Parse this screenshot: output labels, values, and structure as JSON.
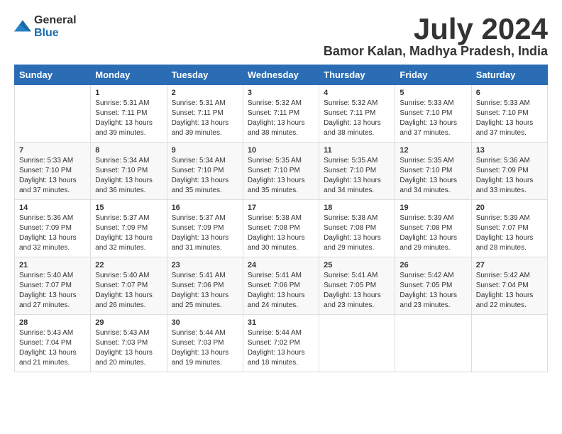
{
  "header": {
    "logo_general": "General",
    "logo_blue": "Blue",
    "month_year": "July 2024",
    "location": "Bamor Kalan, Madhya Pradesh, India"
  },
  "days_of_week": [
    "Sunday",
    "Monday",
    "Tuesday",
    "Wednesday",
    "Thursday",
    "Friday",
    "Saturday"
  ],
  "weeks": [
    [
      {
        "day": "",
        "info": ""
      },
      {
        "day": "1",
        "info": "Sunrise: 5:31 AM\nSunset: 7:11 PM\nDaylight: 13 hours\nand 39 minutes."
      },
      {
        "day": "2",
        "info": "Sunrise: 5:31 AM\nSunset: 7:11 PM\nDaylight: 13 hours\nand 39 minutes."
      },
      {
        "day": "3",
        "info": "Sunrise: 5:32 AM\nSunset: 7:11 PM\nDaylight: 13 hours\nand 38 minutes."
      },
      {
        "day": "4",
        "info": "Sunrise: 5:32 AM\nSunset: 7:11 PM\nDaylight: 13 hours\nand 38 minutes."
      },
      {
        "day": "5",
        "info": "Sunrise: 5:33 AM\nSunset: 7:10 PM\nDaylight: 13 hours\nand 37 minutes."
      },
      {
        "day": "6",
        "info": "Sunrise: 5:33 AM\nSunset: 7:10 PM\nDaylight: 13 hours\nand 37 minutes."
      }
    ],
    [
      {
        "day": "7",
        "info": "Sunrise: 5:33 AM\nSunset: 7:10 PM\nDaylight: 13 hours\nand 37 minutes."
      },
      {
        "day": "8",
        "info": "Sunrise: 5:34 AM\nSunset: 7:10 PM\nDaylight: 13 hours\nand 36 minutes."
      },
      {
        "day": "9",
        "info": "Sunrise: 5:34 AM\nSunset: 7:10 PM\nDaylight: 13 hours\nand 35 minutes."
      },
      {
        "day": "10",
        "info": "Sunrise: 5:35 AM\nSunset: 7:10 PM\nDaylight: 13 hours\nand 35 minutes."
      },
      {
        "day": "11",
        "info": "Sunrise: 5:35 AM\nSunset: 7:10 PM\nDaylight: 13 hours\nand 34 minutes."
      },
      {
        "day": "12",
        "info": "Sunrise: 5:35 AM\nSunset: 7:10 PM\nDaylight: 13 hours\nand 34 minutes."
      },
      {
        "day": "13",
        "info": "Sunrise: 5:36 AM\nSunset: 7:09 PM\nDaylight: 13 hours\nand 33 minutes."
      }
    ],
    [
      {
        "day": "14",
        "info": "Sunrise: 5:36 AM\nSunset: 7:09 PM\nDaylight: 13 hours\nand 32 minutes."
      },
      {
        "day": "15",
        "info": "Sunrise: 5:37 AM\nSunset: 7:09 PM\nDaylight: 13 hours\nand 32 minutes."
      },
      {
        "day": "16",
        "info": "Sunrise: 5:37 AM\nSunset: 7:09 PM\nDaylight: 13 hours\nand 31 minutes."
      },
      {
        "day": "17",
        "info": "Sunrise: 5:38 AM\nSunset: 7:08 PM\nDaylight: 13 hours\nand 30 minutes."
      },
      {
        "day": "18",
        "info": "Sunrise: 5:38 AM\nSunset: 7:08 PM\nDaylight: 13 hours\nand 29 minutes."
      },
      {
        "day": "19",
        "info": "Sunrise: 5:39 AM\nSunset: 7:08 PM\nDaylight: 13 hours\nand 29 minutes."
      },
      {
        "day": "20",
        "info": "Sunrise: 5:39 AM\nSunset: 7:07 PM\nDaylight: 13 hours\nand 28 minutes."
      }
    ],
    [
      {
        "day": "21",
        "info": "Sunrise: 5:40 AM\nSunset: 7:07 PM\nDaylight: 13 hours\nand 27 minutes."
      },
      {
        "day": "22",
        "info": "Sunrise: 5:40 AM\nSunset: 7:07 PM\nDaylight: 13 hours\nand 26 minutes."
      },
      {
        "day": "23",
        "info": "Sunrise: 5:41 AM\nSunset: 7:06 PM\nDaylight: 13 hours\nand 25 minutes."
      },
      {
        "day": "24",
        "info": "Sunrise: 5:41 AM\nSunset: 7:06 PM\nDaylight: 13 hours\nand 24 minutes."
      },
      {
        "day": "25",
        "info": "Sunrise: 5:41 AM\nSunset: 7:05 PM\nDaylight: 13 hours\nand 23 minutes."
      },
      {
        "day": "26",
        "info": "Sunrise: 5:42 AM\nSunset: 7:05 PM\nDaylight: 13 hours\nand 23 minutes."
      },
      {
        "day": "27",
        "info": "Sunrise: 5:42 AM\nSunset: 7:04 PM\nDaylight: 13 hours\nand 22 minutes."
      }
    ],
    [
      {
        "day": "28",
        "info": "Sunrise: 5:43 AM\nSunset: 7:04 PM\nDaylight: 13 hours\nand 21 minutes."
      },
      {
        "day": "29",
        "info": "Sunrise: 5:43 AM\nSunset: 7:03 PM\nDaylight: 13 hours\nand 20 minutes."
      },
      {
        "day": "30",
        "info": "Sunrise: 5:44 AM\nSunset: 7:03 PM\nDaylight: 13 hours\nand 19 minutes."
      },
      {
        "day": "31",
        "info": "Sunrise: 5:44 AM\nSunset: 7:02 PM\nDaylight: 13 hours\nand 18 minutes."
      },
      {
        "day": "",
        "info": ""
      },
      {
        "day": "",
        "info": ""
      },
      {
        "day": "",
        "info": ""
      }
    ]
  ]
}
